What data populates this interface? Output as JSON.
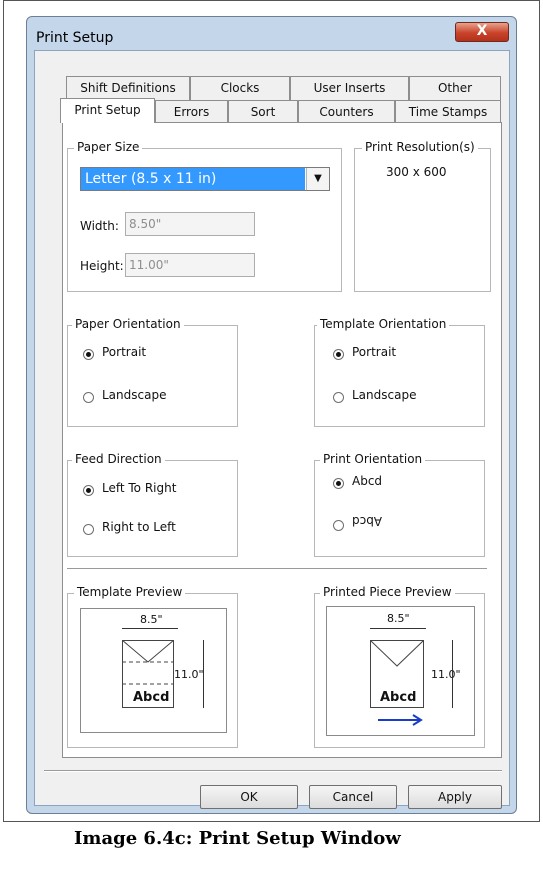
{
  "window": {
    "title": "Print Setup",
    "close_glyph": "X"
  },
  "tabs_back": [
    "Shift Definitions",
    "Clocks",
    "User Inserts",
    "Other"
  ],
  "tabs_front": [
    "Print Setup",
    "Errors",
    "Sort",
    "Counters",
    "Time Stamps"
  ],
  "paper_size": {
    "legend": "Paper Size",
    "selected": "Letter (8.5 x 11 in)",
    "width_label": "Width:",
    "width_value": "8.50\"",
    "height_label": "Height:",
    "height_value": "11.00\""
  },
  "print_resolution": {
    "legend": "Print Resolution(s)",
    "value": "300 x 600"
  },
  "paper_orientation": {
    "legend": "Paper Orientation",
    "options": [
      "Portrait",
      "Landscape"
    ],
    "selected": "Portrait"
  },
  "template_orientation": {
    "legend": "Template Orientation",
    "options": [
      "Portrait",
      "Landscape"
    ],
    "selected": "Portrait"
  },
  "feed_direction": {
    "legend": "Feed Direction",
    "options": [
      "Left To Right",
      "Right to Left"
    ],
    "selected": "Left To Right"
  },
  "print_orientation": {
    "legend": "Print Orientation",
    "options": [
      "Abcd",
      "Abcd"
    ],
    "selected": "Abcd"
  },
  "template_preview": {
    "legend": "Template Preview",
    "width": "8.5\"",
    "height": "11.0\"",
    "sample": "Abcd"
  },
  "printed_preview": {
    "legend": "Printed Piece Preview",
    "width": "8.5\"",
    "height": "11.0\"",
    "sample": "Abcd"
  },
  "buttons": {
    "ok": "OK",
    "cancel": "Cancel",
    "apply": "Apply"
  },
  "caption": "Image 6.4c: Print Setup Window"
}
